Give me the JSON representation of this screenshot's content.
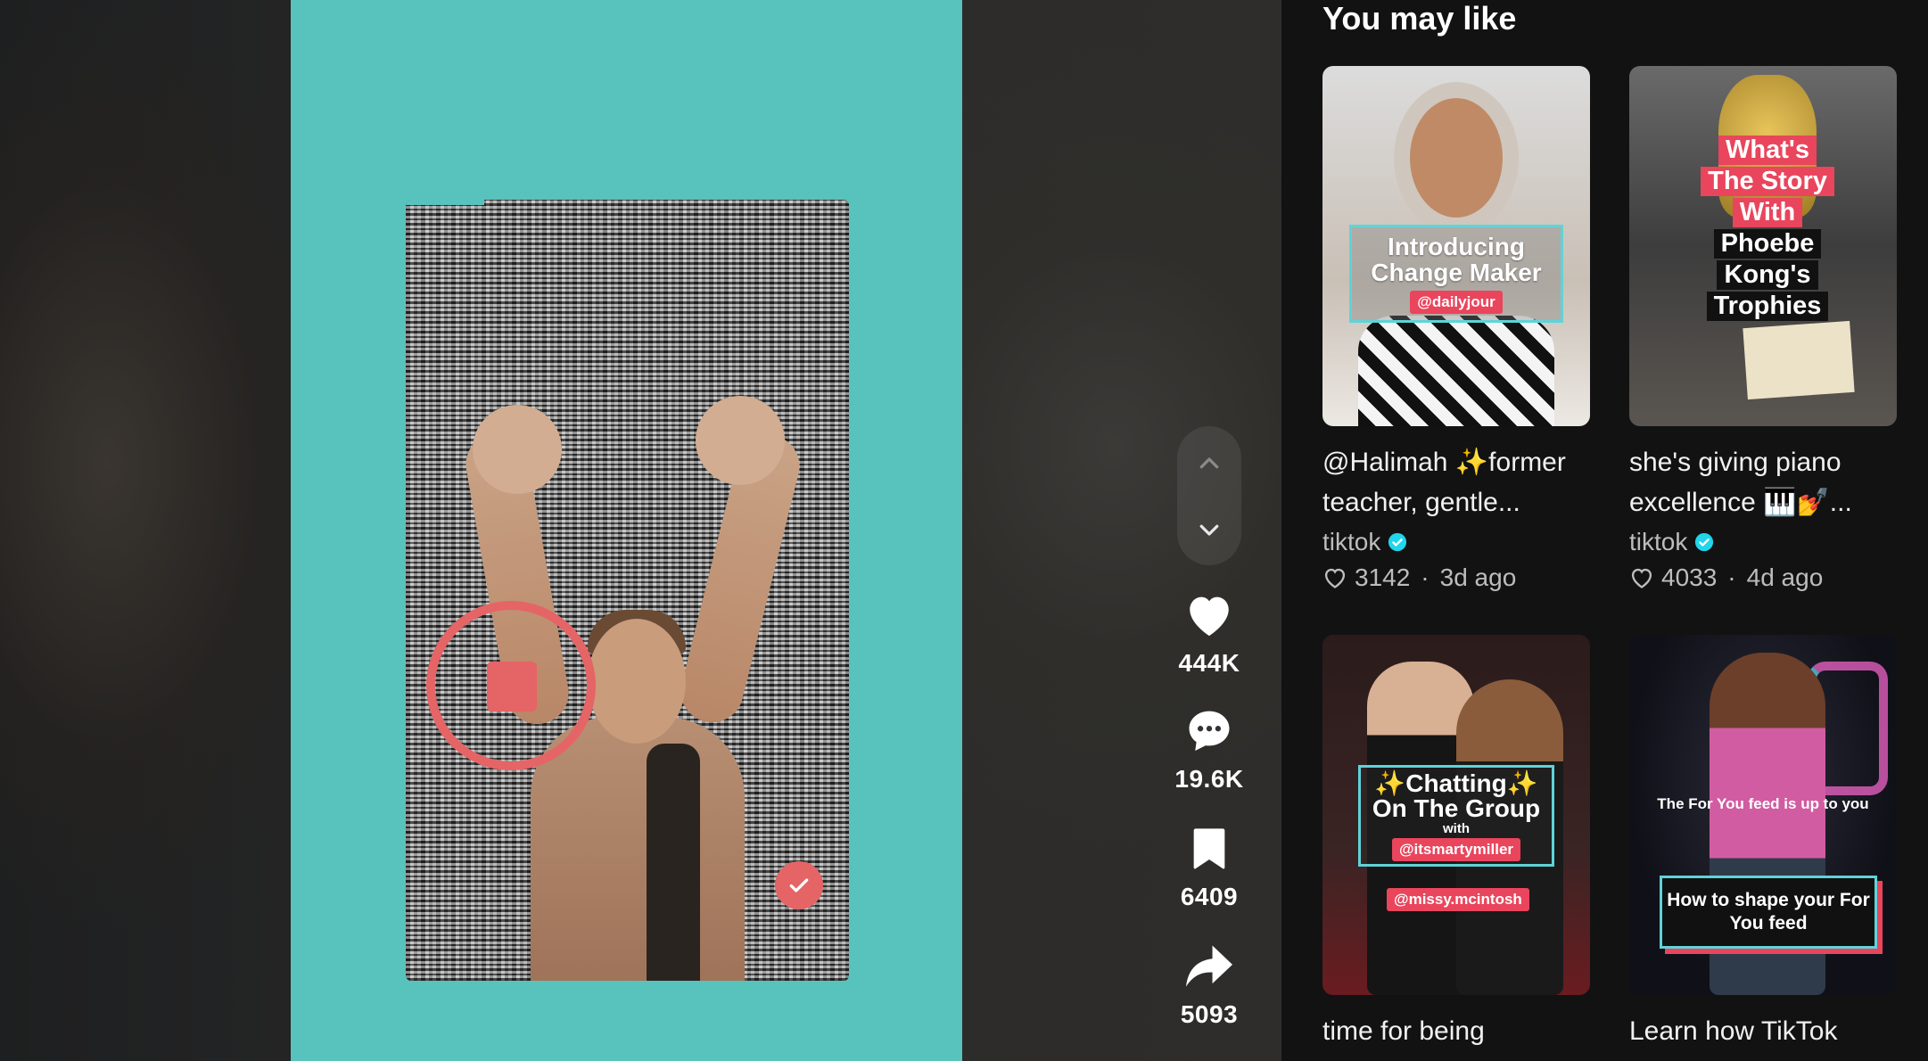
{
  "player": {
    "actions": {
      "likes": "444K",
      "comments": "19.6K",
      "saves": "6409",
      "shares": "5093"
    }
  },
  "sidebar": {
    "title": "You may like",
    "cards": [
      {
        "caption": "@Halimah ✨former teacher, gentle...",
        "author": "tiktok",
        "likes": "3142",
        "age": "3d ago",
        "overlay": {
          "line1": "Introducing",
          "line2": "Change Maker",
          "tag": "@dailyjour"
        }
      },
      {
        "caption": "she's giving piano excellence 🎹💅...",
        "author": "tiktok",
        "likes": "4033",
        "age": "4d ago",
        "overlay": {
          "l1": "What's",
          "l2": "The Story",
          "l3": "With",
          "l4": "Phoebe",
          "l5": "Kong's",
          "l6": "Trophies"
        }
      },
      {
        "caption": "time for being",
        "overlay": {
          "line1": "✨Chatting✨",
          "line2": "On The Group",
          "with": "with",
          "tag1": "@itsmartymiller",
          "tag2": "@missy.mcintosh"
        }
      },
      {
        "caption": "Learn how TikTok",
        "overlay": {
          "note": "The For You feed is up to you",
          "box": "How to shape your For You feed"
        }
      }
    ]
  },
  "colors": {
    "teal": "#58c2bd",
    "record_red": "#e56466",
    "verified": "#20d5ec",
    "tag_pink": "#e9455c"
  }
}
